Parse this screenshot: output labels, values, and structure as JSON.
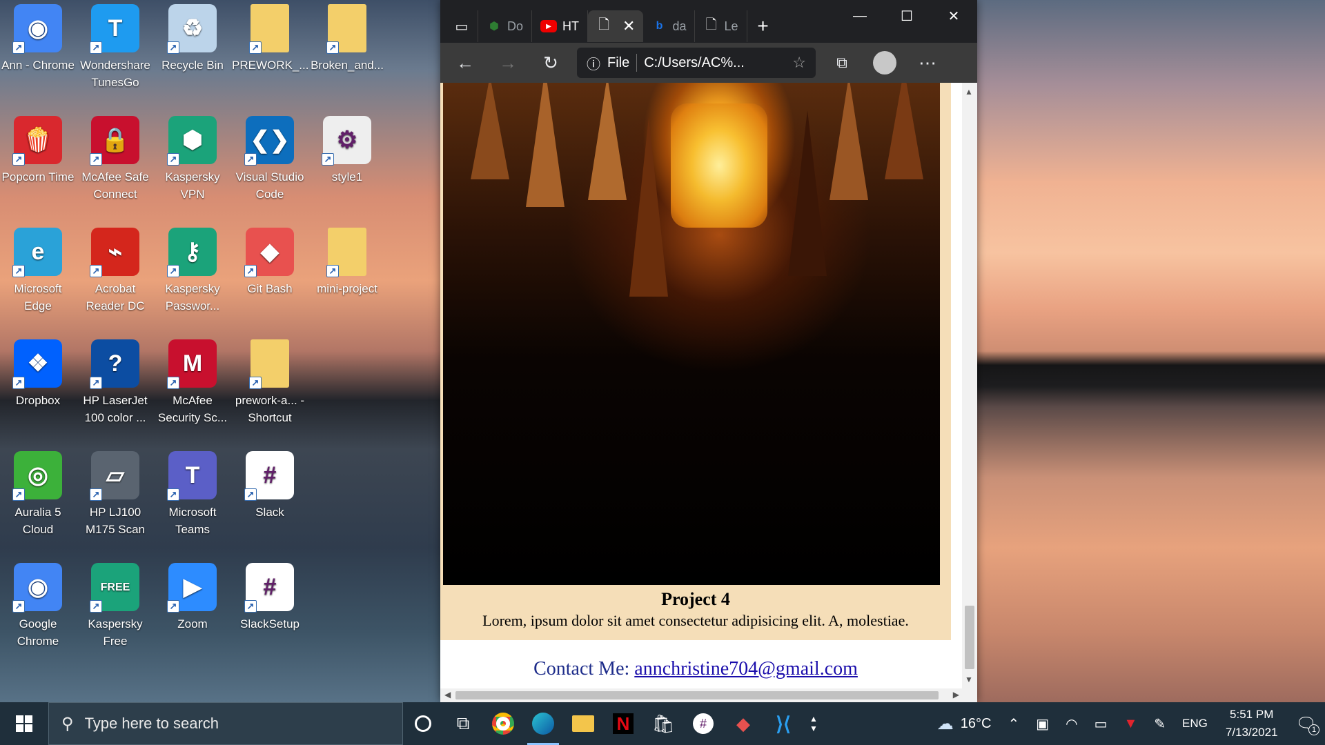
{
  "desktop": {
    "icons": [
      {
        "label": "Ann - Chrome",
        "icon": "chrome-icon",
        "color": "#4285f4"
      },
      {
        "label": "Wondershare TunesGo",
        "icon": "tunesgo-icon",
        "color": "#1e9bf0"
      },
      {
        "label": "Recycle Bin",
        "icon": "recycle-bin-icon",
        "color": "#bcd4ea"
      },
      {
        "label": "PREWORK_...",
        "icon": "folder-icon",
        "color": "#f3cf6a"
      },
      {
        "label": "Broken_and...",
        "icon": "zip-folder-icon",
        "color": "#f3cf6a"
      },
      {
        "label": "Popcorn Time",
        "icon": "popcorn-icon",
        "color": "#d9282e"
      },
      {
        "label": "McAfee Safe Connect",
        "icon": "mcafee-safe-connect-icon",
        "color": "#c8102e"
      },
      {
        "label": "Kaspersky VPN",
        "icon": "kaspersky-vpn-icon",
        "color": "#1ba37a"
      },
      {
        "label": "Visual Studio Code",
        "icon": "vscode-icon",
        "color": "#0d6ebd"
      },
      {
        "label": "style1",
        "icon": "css-file-icon",
        "color": "#eeeeee"
      },
      {
        "label": "Microsoft Edge",
        "icon": "edge-icon",
        "color": "#2aa2d8"
      },
      {
        "label": "Acrobat Reader DC",
        "icon": "acrobat-icon",
        "color": "#d4261c"
      },
      {
        "label": "Kaspersky Passwor...",
        "icon": "kaspersky-password-icon",
        "color": "#1ba37a"
      },
      {
        "label": "Git Bash",
        "icon": "git-bash-icon",
        "color": "#e8514f"
      },
      {
        "label": "mini-project",
        "icon": "folder-icon",
        "color": "#f3cf6a"
      },
      {
        "label": "Dropbox",
        "icon": "dropbox-icon",
        "color": "#0061fe"
      },
      {
        "label": "HP LaserJet 100 color ...",
        "icon": "hp-help-icon",
        "color": "#0c4da2"
      },
      {
        "label": "McAfee Security Sc...",
        "icon": "mcafee-icon",
        "color": "#c8102e"
      },
      {
        "label": "prework-a... - Shortcut",
        "icon": "folder-shortcut-icon",
        "color": "#f3cf6a"
      },
      {
        "label": "",
        "icon": "",
        "color": ""
      },
      {
        "label": "Auralia 5 Cloud",
        "icon": "auralia-icon",
        "color": "#3cb13a"
      },
      {
        "label": "HP LJ100 M175 Scan",
        "icon": "scanner-icon",
        "color": "#5a6470"
      },
      {
        "label": "Microsoft Teams",
        "icon": "teams-icon",
        "color": "#5b5fc7"
      },
      {
        "label": "Slack",
        "icon": "slack-icon",
        "color": "#ffffff"
      },
      {
        "label": "",
        "icon": "",
        "color": ""
      },
      {
        "label": "Google Chrome",
        "icon": "chrome-icon",
        "color": "#4285f4"
      },
      {
        "label": "Kaspersky Free",
        "icon": "kaspersky-free-icon",
        "color": "#1ba37a"
      },
      {
        "label": "Zoom",
        "icon": "zoom-icon",
        "color": "#2d8cff"
      },
      {
        "label": "SlackSetup",
        "icon": "slack-icon",
        "color": "#ffffff"
      }
    ]
  },
  "browser": {
    "tabs": [
      {
        "label": "Do",
        "icon": "shield-icon"
      },
      {
        "label": "HT",
        "icon": "youtube-icon"
      },
      {
        "label": "",
        "icon": "page-icon",
        "active": true
      },
      {
        "label": "da",
        "icon": "bing-icon"
      },
      {
        "label": "Le",
        "icon": "page-icon"
      }
    ],
    "address": {
      "scheme": "File",
      "url": "C:/Users/AC%..."
    },
    "page": {
      "project_title": "Project 4",
      "project_desc": "Lorem, ipsum dolor sit amet consectetur adipisicing elit. A, molestiae.",
      "contact_label": "Contact Me:",
      "contact_email": "annchristine704@gmail.com"
    }
  },
  "taskbar": {
    "search_placeholder": "Type here to search",
    "weather": "16°C",
    "language": "ENG",
    "time": "5:51 PM",
    "date": "7/13/2021",
    "notifications": "1"
  },
  "colors": {
    "card_bg": "#f5deb8",
    "taskbar": "#1f2f3b",
    "browser_dark": "#202124"
  }
}
